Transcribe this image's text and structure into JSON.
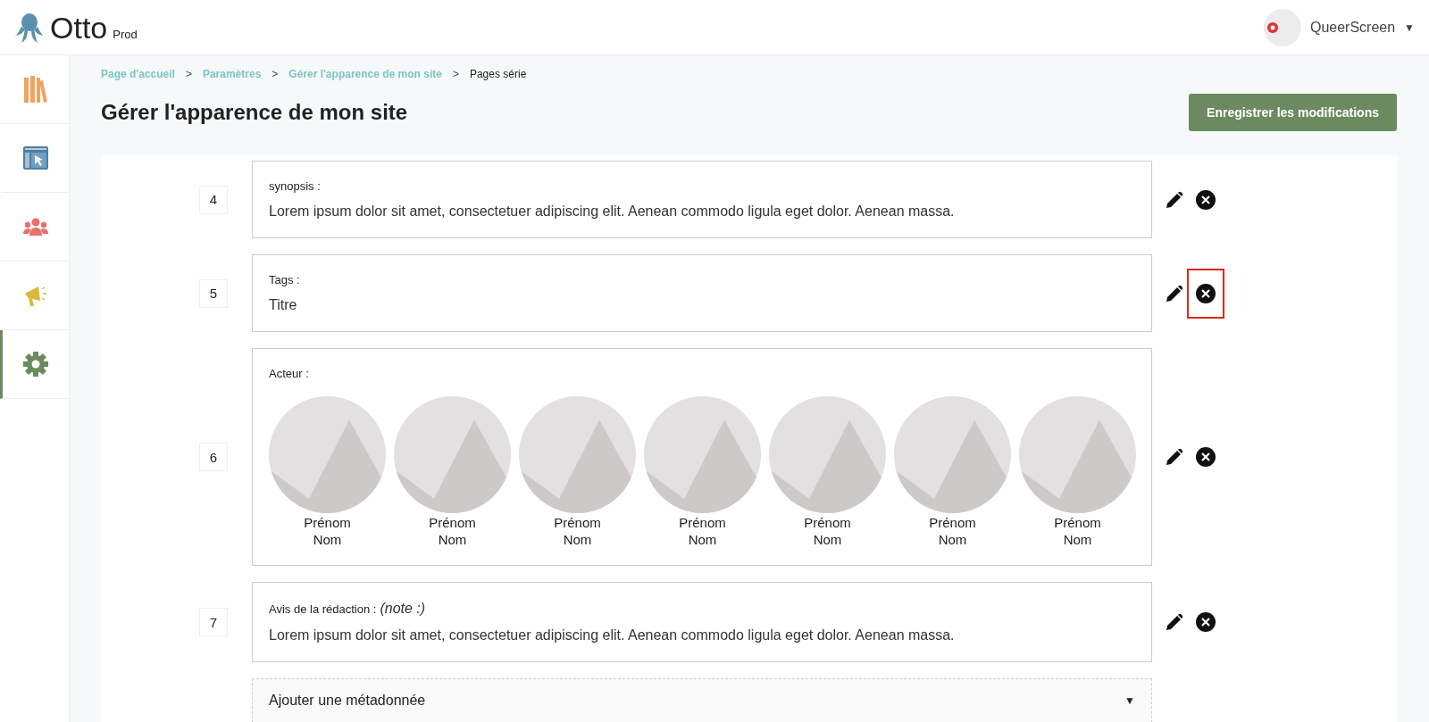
{
  "header": {
    "logo": "Otto",
    "logo_suffix": "Prod",
    "account": {
      "name": "QueerScreen",
      "caret": "▼"
    }
  },
  "sidebar": {
    "items": [
      {
        "kind": "books",
        "selected": false
      },
      {
        "kind": "layout",
        "selected": false
      },
      {
        "kind": "users",
        "selected": false
      },
      {
        "kind": "megaphone",
        "selected": false
      },
      {
        "kind": "settings",
        "selected": true
      }
    ]
  },
  "breadcrumb": [
    {
      "label": "Page d'accueil",
      "link": true
    },
    {
      "label": "Paramètres",
      "link": true
    },
    {
      "label": "Gérer l'apparence de mon site",
      "link": true
    },
    {
      "label": "Pages série",
      "link": false
    }
  ],
  "breadcrumb_separator": ">",
  "title": "Gérer l'apparence de mon site",
  "save_button": "Enregistrer les modifications",
  "rows": [
    {
      "number": "4",
      "kind": "text",
      "label": "synopsis :",
      "value": "Lorem ipsum dolor sit amet, consectetuer adipiscing elit. Aenean commodo ligula eget dolor. Aenean massa.",
      "delete_highlighted": false
    },
    {
      "number": "5",
      "kind": "text",
      "label": "Tags :",
      "value": "Titre",
      "delete_highlighted": true
    },
    {
      "number": "6",
      "kind": "people",
      "label": "Acteur :",
      "people": [
        {
          "first": "Prénom",
          "last": "Nom"
        },
        {
          "first": "Prénom",
          "last": "Nom"
        },
        {
          "first": "Prénom",
          "last": "Nom"
        },
        {
          "first": "Prénom",
          "last": "Nom"
        },
        {
          "first": "Prénom",
          "last": "Nom"
        },
        {
          "first": "Prénom",
          "last": "Nom"
        },
        {
          "first": "Prénom",
          "last": "Nom"
        }
      ],
      "delete_highlighted": false
    },
    {
      "number": "7",
      "kind": "text",
      "label": "Avis de la rédaction :",
      "hint": "(note :)",
      "value": "Lorem ipsum dolor sit amet, consectetuer adipiscing elit. Aenean commodo ligula eget dolor. Aenean massa.",
      "delete_highlighted": false
    }
  ],
  "add_metadata": {
    "label": "Ajouter une métadonnée",
    "caret": "▼"
  }
}
